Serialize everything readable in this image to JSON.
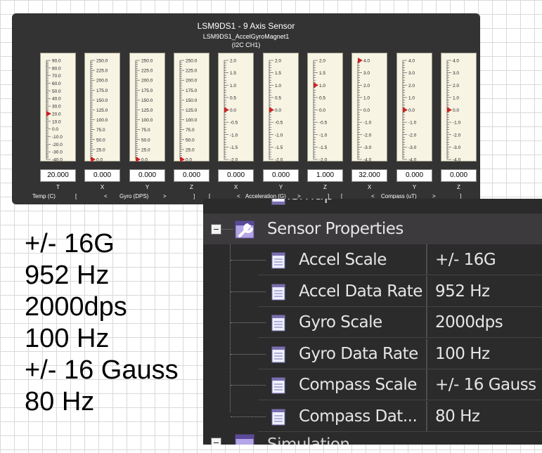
{
  "panel": {
    "title": "LSM9DS1 - 9 Axis Sensor",
    "subtitle": "LSM9DS1_AccelGyroMagnet1",
    "bus": "(I2C CH1)",
    "gauges": [
      {
        "axis": "T",
        "value": "20.000",
        "current": 20,
        "ticks": [
          "90.0",
          "80.0",
          "70.0",
          "60.0",
          "50.0",
          "40.0",
          "30.0",
          "20.0",
          "10.0",
          "0.0",
          "-10.0",
          "-20.0",
          "-30.0",
          "-40.0"
        ],
        "range": [
          -40,
          90
        ]
      },
      {
        "axis": "X",
        "value": "0.000",
        "current": 0,
        "ticks": [
          "250.0",
          "225.0",
          "200.0",
          "175.0",
          "150.0",
          "125.0",
          "100.0",
          "75.0",
          "50.0",
          "25.0",
          "0.0"
        ],
        "range": [
          0,
          250
        ]
      },
      {
        "axis": "Y",
        "value": "0.000",
        "current": 0,
        "ticks": [
          "250.0",
          "225.0",
          "200.0",
          "175.0",
          "150.0",
          "125.0",
          "100.0",
          "75.0",
          "50.0",
          "25.0",
          "0.0"
        ],
        "range": [
          0,
          250
        ]
      },
      {
        "axis": "Z",
        "value": "0.000",
        "current": 0,
        "ticks": [
          "250.0",
          "225.0",
          "200.0",
          "175.0",
          "150.0",
          "125.0",
          "100.0",
          "75.0",
          "50.0",
          "25.0",
          "0.0"
        ],
        "range": [
          0,
          250
        ]
      },
      {
        "axis": "X",
        "value": "0.000",
        "current": 0,
        "ticks": [
          "2.0",
          "1.5",
          "1.0",
          "0.5",
          "0.0",
          "-0.5",
          "-1.0",
          "-1.5",
          "-2.0"
        ],
        "range": [
          -2,
          2
        ]
      },
      {
        "axis": "Y",
        "value": "0.000",
        "current": 0,
        "ticks": [
          "2.0",
          "1.5",
          "1.0",
          "0.5",
          "0.0",
          "-0.5",
          "-1.0",
          "-1.5",
          "-2.0"
        ],
        "range": [
          -2,
          2
        ]
      },
      {
        "axis": "Z",
        "value": "1.000",
        "current": 1,
        "ticks": [
          "2.0",
          "1.5",
          "1.0",
          "0.5",
          "0.0",
          "-0.5",
          "-1.0",
          "-1.5",
          "-2.0"
        ],
        "range": [
          -2,
          2
        ]
      },
      {
        "axis": "X",
        "value": "32.000",
        "current": 4,
        "ticks": [
          "4.0",
          "3.0",
          "2.0",
          "1.0",
          "0.0",
          "-1.0",
          "-2.0",
          "-3.0",
          "-4.0"
        ],
        "range": [
          -4,
          4
        ]
      },
      {
        "axis": "Y",
        "value": "0.000",
        "current": 0,
        "ticks": [
          "4.0",
          "3.0",
          "2.0",
          "1.0",
          "0.0",
          "-1.0",
          "-2.0",
          "-3.0",
          "-4.0"
        ],
        "range": [
          -4,
          4
        ]
      },
      {
        "axis": "Z",
        "value": "0.000",
        "current": 0,
        "ticks": [
          "4.0",
          "3.0",
          "2.0",
          "1.0",
          "0.0",
          "-1.0",
          "-2.0",
          "-3.0",
          "-4.0"
        ],
        "range": [
          -4,
          4
        ]
      }
    ],
    "groups": {
      "temp": "Temp (C)",
      "gyro_open": "[",
      "gyro_lt": "<",
      "gyro": "Gyro (DPS)",
      "gyro_gt": ">",
      "gyro_close": "]",
      "accel_open": "[",
      "accel_lt": "<",
      "accel": "Acceleration (G)",
      "accel_gt": ">",
      "accel_close": "]",
      "comp_open": "[",
      "comp_lt": "<",
      "comp": "Compass (uT)",
      "comp_gt": ">",
      "comp_close": "]"
    }
  },
  "property_grid": {
    "category": "Sensor Properties",
    "rows": [
      {
        "name": "Accel Scale",
        "value": "+/- 16G"
      },
      {
        "name": "Accel Data Rate",
        "value": "952 Hz"
      },
      {
        "name": "Gyro Scale",
        "value": "2000dps"
      },
      {
        "name": "Gyro Data Rate",
        "value": "100 Hz"
      },
      {
        "name": "Compass Scale",
        "value": "+/- 16 Gauss"
      },
      {
        "name": "Compass Dat...",
        "value": "80 Hz"
      }
    ]
  },
  "big_text": [
    "+/- 16G",
    "952 Hz",
    "2000dps",
    "100 Hz",
    "+/- 16 Gauss",
    "80 Hz"
  ],
  "colors": {
    "panel_bg": "#333333",
    "gauge_face": "#f7f4e4",
    "marker": "#cc2222",
    "grid_bg": "#2b2b2b",
    "category_bg": "#3c3a3c"
  }
}
